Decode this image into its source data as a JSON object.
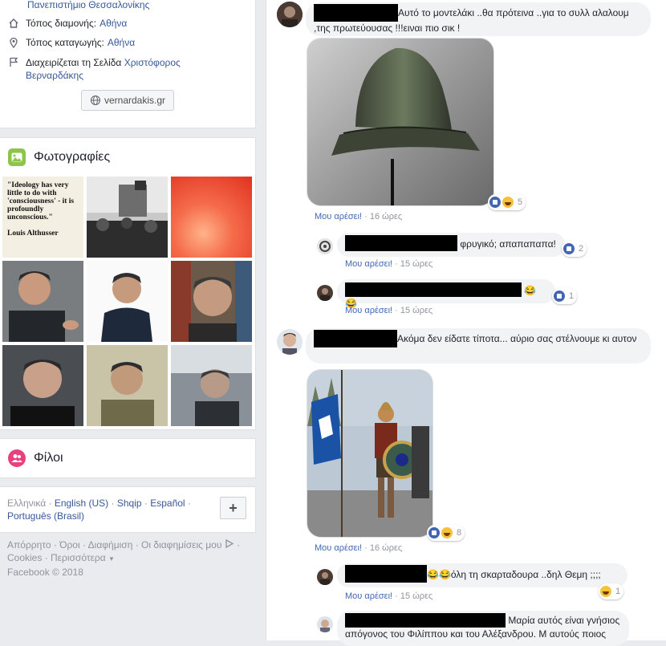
{
  "intro": {
    "university": "Πανεπιστήμιο Θεσσαλονίκης",
    "lives_label": "Τόπος διαμονής:",
    "lives_value": "Αθήνα",
    "from_label": "Τόπος καταγωγής:",
    "from_value": "Αθήνα",
    "manages_label": "Διαχειρίζεται τη Σελίδα",
    "manages_value": "Χριστόφορος Βερναρδάκης",
    "website": "vernardakis.gr"
  },
  "photos": {
    "title": "Φωτογραφίες",
    "quote": "\"Ideology has very little to do with 'consciousness' - it is profoundly unconscious.\"",
    "quote_author": "Louis Althusser"
  },
  "friends": {
    "title": "Φίλοι"
  },
  "languages": {
    "current": "Ελληνικά",
    "items": [
      "English (US)",
      "Shqip",
      "Español",
      "Português (Brasil)"
    ],
    "add_button": "+"
  },
  "footer": {
    "line1": "Απόρρητο · Όροι · Διαφήμιση · Οι διαφημίσεις μου",
    "line2": "Cookies · Περισσότερα",
    "copyright": "Facebook © 2018"
  },
  "comments": [
    {
      "text": "Αυτό το μοντελάκι ..θα πρότεινα ..για το συλλ αλαλουμ ,της πρωτεύουσας !!!ειναι πιο σικ !",
      "like": "Μου αρέσει!",
      "time": "16 ώρες",
      "reactions": "5"
    },
    {
      "text": "φρυγικό; απαπαπαπα!",
      "like": "Μου αρέσει!",
      "time": "15 ώρες",
      "reactions": "2"
    },
    {
      "text": "😂😂",
      "like": "Μου αρέσει!",
      "time": "15 ώρες",
      "reactions": "1"
    },
    {
      "text": "Ακόμα δεν είδατε τίποτα... αύριο σας στέλνουμε κι αυτον",
      "like": "Μου αρέσει!",
      "time": "16 ώρες",
      "reactions": "8"
    },
    {
      "text": "😂😂όλη τη σκαρταδουρα ..δηλ Θεμη ;;;;",
      "like": "Μου αρέσει!",
      "time": "15 ώρες",
      "reactions": "1"
    },
    {
      "text": "Μαρία αυτός είναι γνήσιος απόγονος του Φιλίππου και του Αλέξανδρου. Μ αυτούς ποιος"
    }
  ],
  "colors": {
    "link": "#385898",
    "like_blue": "#4267b2",
    "meta_gray": "#90949c",
    "bubble": "#f2f3f5"
  }
}
